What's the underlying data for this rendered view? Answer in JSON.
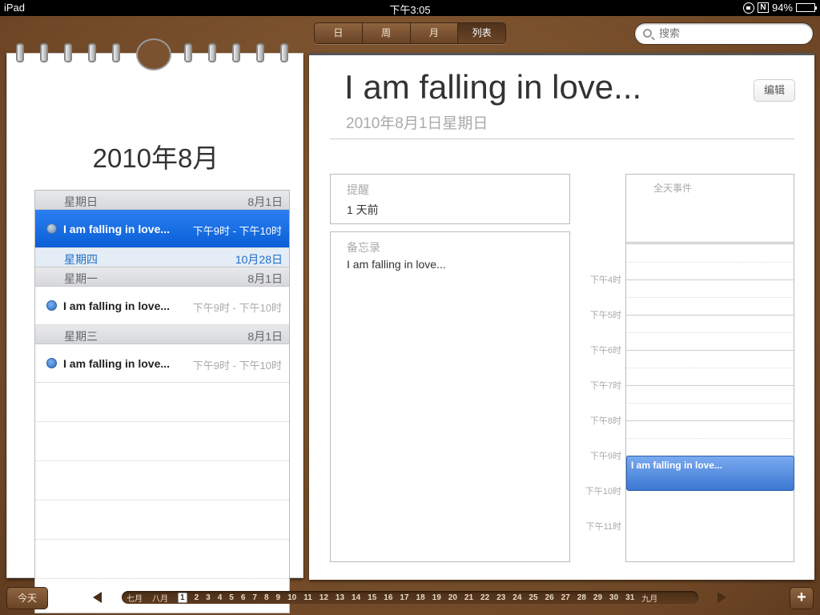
{
  "status": {
    "device": "iPad",
    "time": "下午3:05",
    "battery": "94%",
    "battery_level": 0.94
  },
  "toolbar": {
    "views": [
      "日",
      "周",
      "月",
      "列表"
    ],
    "active_view": 3,
    "search_placeholder": "搜索"
  },
  "left": {
    "month_title": "2010年8月",
    "list": [
      {
        "type": "header",
        "name": "星期日",
        "date": "8月1日",
        "style": "gray"
      },
      {
        "type": "event",
        "title": "I am falling in love...",
        "time": "下午9时 - 下午10时",
        "selected": true
      },
      {
        "type": "header",
        "name": "星期四",
        "date": "10月28日",
        "style": "blue"
      },
      {
        "type": "header",
        "name": "星期一",
        "date": "8月1日",
        "style": "gray"
      },
      {
        "type": "event",
        "title": "I am falling in love...",
        "time": "下午9时 - 下午10时",
        "selected": false
      },
      {
        "type": "header",
        "name": "星期三",
        "date": "8月1日",
        "style": "gray"
      },
      {
        "type": "event",
        "title": "I am falling in love...",
        "time": "下午9时 - 下午10时",
        "selected": false
      }
    ]
  },
  "detail": {
    "title": "I am falling in love...",
    "date": "2010年8月1日星期日",
    "edit_label": "编辑",
    "reminder_label": "提醒",
    "reminder_value": "1 天前",
    "notes_label": "备忘录",
    "notes_value": "I am falling in love...",
    "allday_label": "全天事件",
    "hours": [
      "下午4时",
      "下午5时",
      "下午6时",
      "下午7时",
      "下午8时",
      "下午9时",
      "下午10时",
      "下午11时"
    ],
    "timeline_event": "I am falling in love..."
  },
  "bottom": {
    "today_label": "今天",
    "add_label": "+",
    "prev_month": "七月",
    "cur_month": "八月",
    "next_month": "九月",
    "days": [
      "1",
      "2",
      "3",
      "4",
      "5",
      "6",
      "7",
      "8",
      "9",
      "10",
      "11",
      "12",
      "13",
      "14",
      "15",
      "16",
      "17",
      "18",
      "19",
      "20",
      "21",
      "22",
      "23",
      "24",
      "25",
      "26",
      "27",
      "28",
      "29",
      "30",
      "31"
    ],
    "current_day": "1"
  }
}
